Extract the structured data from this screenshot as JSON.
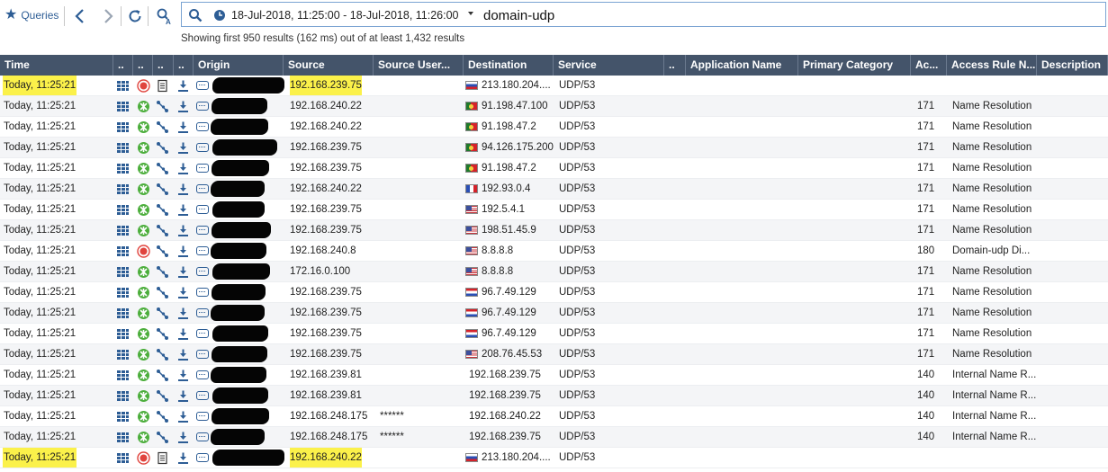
{
  "toolbar": {
    "queries_label": "Queries",
    "time_range": "18-Jul-2018, 11:25:00 - 18-Jul-2018, 11:26:00",
    "query": "domain-udp",
    "summary": "Showing first 950 results (162 ms) out of at least 1,432 results"
  },
  "colors": {
    "header_bg": "#44546a",
    "accent_blue": "#2d5d95",
    "highlight": "#fbf14a",
    "accept_green": "#4cae3c",
    "drop_red": "#e0443e"
  },
  "columns": [
    {
      "key": "time",
      "label": "Time"
    },
    {
      "key": "c1",
      "label": ".."
    },
    {
      "key": "c2",
      "label": ".."
    },
    {
      "key": "c3",
      "label": ".."
    },
    {
      "key": "c4",
      "label": ".."
    },
    {
      "key": "origin",
      "label": "Origin"
    },
    {
      "key": "source",
      "label": "Source"
    },
    {
      "key": "source_user",
      "label": "Source User..."
    },
    {
      "key": "destination",
      "label": "Destination"
    },
    {
      "key": "service",
      "label": "Service"
    },
    {
      "key": "c5",
      "label": ".."
    },
    {
      "key": "app",
      "label": "Application Name"
    },
    {
      "key": "category",
      "label": "Primary Category"
    },
    {
      "key": "ac",
      "label": "Ac..."
    },
    {
      "key": "rule_name",
      "label": "Access Rule N..."
    },
    {
      "key": "description",
      "label": "Description"
    }
  ],
  "icons": {
    "type": "grid-icon",
    "accept": "accept-icon",
    "drop": "drop-icon",
    "flow": "connection-icon",
    "doc": "log-document-icon",
    "download": "download-icon",
    "origin": "gateway-icon"
  },
  "rows": [
    {
      "time": "Today, 11:25:21",
      "action": "drop",
      "detail": "doc",
      "source": "192.168.239.75",
      "source_user": "",
      "flag": "ru",
      "destination": "213.180.204....",
      "service": "UDP/53",
      "ac": "",
      "rule_name": "",
      "time_hl": true,
      "src_hl": true,
      "redact_w": 80
    },
    {
      "time": "Today, 11:25:21",
      "action": "accept",
      "detail": "flow",
      "source": "192.168.240.22",
      "source_user": "",
      "flag": "pt",
      "destination": "91.198.47.100",
      "service": "UDP/53",
      "ac": "171",
      "rule_name": "Name Resolution",
      "redact_w": 62
    },
    {
      "time": "Today, 11:25:21",
      "action": "accept",
      "detail": "flow",
      "source": "192.168.240.22",
      "source_user": "",
      "flag": "pt",
      "destination": "91.198.47.2",
      "service": "UDP/53",
      "ac": "171",
      "rule_name": "Name Resolution",
      "redact_w": 64
    },
    {
      "time": "Today, 11:25:21",
      "action": "accept",
      "detail": "flow",
      "source": "192.168.239.75",
      "source_user": "",
      "flag": "pt",
      "destination": "94.126.175.200",
      "service": "UDP/53",
      "ac": "171",
      "rule_name": "Name Resolution",
      "redact_w": 72
    },
    {
      "time": "Today, 11:25:21",
      "action": "accept",
      "detail": "flow",
      "source": "192.168.239.75",
      "source_user": "",
      "flag": "pt",
      "destination": "91.198.47.2",
      "service": "UDP/53",
      "ac": "171",
      "rule_name": "Name Resolution",
      "redact_w": 64
    },
    {
      "time": "Today, 11:25:21",
      "action": "accept",
      "detail": "flow",
      "source": "192.168.240.22",
      "source_user": "",
      "flag": "fr",
      "destination": "192.93.0.4",
      "service": "UDP/53",
      "ac": "171",
      "rule_name": "Name Resolution",
      "redact_w": 60
    },
    {
      "time": "Today, 11:25:21",
      "action": "accept",
      "detail": "flow",
      "source": "192.168.239.75",
      "source_user": "",
      "flag": "us",
      "destination": "192.5.4.1",
      "service": "UDP/53",
      "ac": "171",
      "rule_name": "Name Resolution",
      "redact_w": 58
    },
    {
      "time": "Today, 11:25:21",
      "action": "accept",
      "detail": "flow",
      "source": "192.168.239.75",
      "source_user": "",
      "flag": "us",
      "destination": "198.51.45.9",
      "service": "UDP/53",
      "ac": "171",
      "rule_name": "Name Resolution",
      "redact_w": 66
    },
    {
      "time": "Today, 11:25:21",
      "action": "drop",
      "detail": "flow",
      "source": "192.168.240.8",
      "source_user": "",
      "flag": "us",
      "destination": "8.8.8.8",
      "service": "UDP/53",
      "ac": "180",
      "rule_name": "Domain-udp Di...",
      "redact_w": 62
    },
    {
      "time": "Today, 11:25:21",
      "action": "accept",
      "detail": "flow",
      "source": "172.16.0.100",
      "source_user": "",
      "flag": "us",
      "destination": "8.8.8.8",
      "service": "UDP/53",
      "ac": "171",
      "rule_name": "Name Resolution",
      "redact_w": 64
    },
    {
      "time": "Today, 11:25:21",
      "action": "accept",
      "detail": "flow",
      "source": "192.168.239.75",
      "source_user": "",
      "flag": "nl",
      "destination": "96.7.49.129",
      "service": "UDP/53",
      "ac": "171",
      "rule_name": "Name Resolution",
      "redact_w": 60
    },
    {
      "time": "Today, 11:25:21",
      "action": "accept",
      "detail": "flow",
      "source": "192.168.239.75",
      "source_user": "",
      "flag": "nl",
      "destination": "96.7.49.129",
      "service": "UDP/53",
      "ac": "171",
      "rule_name": "Name Resolution",
      "redact_w": 60
    },
    {
      "time": "Today, 11:25:21",
      "action": "accept",
      "detail": "flow",
      "source": "192.168.239.75",
      "source_user": "",
      "flag": "nl",
      "destination": "96.7.49.129",
      "service": "UDP/53",
      "ac": "171",
      "rule_name": "Name Resolution",
      "redact_w": 62
    },
    {
      "time": "Today, 11:25:21",
      "action": "accept",
      "detail": "flow",
      "source": "192.168.239.75",
      "source_user": "",
      "flag": "us",
      "destination": "208.76.45.53",
      "service": "UDP/53",
      "ac": "171",
      "rule_name": "Name Resolution",
      "redact_w": 62
    },
    {
      "time": "Today, 11:25:21",
      "action": "accept",
      "detail": "flow",
      "source": "192.168.239.81",
      "source_user": "",
      "flag": "none",
      "destination": "192.168.239.75",
      "service": "UDP/53",
      "ac": "140",
      "rule_name": "Internal Name R...",
      "redact_w": 62
    },
    {
      "time": "Today, 11:25:21",
      "action": "accept",
      "detail": "flow",
      "source": "192.168.239.81",
      "source_user": "",
      "flag": "none",
      "destination": "192.168.239.75",
      "service": "UDP/53",
      "ac": "140",
      "rule_name": "Internal Name R...",
      "redact_w": 62
    },
    {
      "time": "Today, 11:25:21",
      "action": "accept",
      "detail": "flow",
      "source": "192.168.248.175",
      "source_user": "******",
      "flag": "none",
      "destination": "192.168.240.22",
      "service": "UDP/53",
      "ac": "140",
      "rule_name": "Internal Name R...",
      "redact_w": 64
    },
    {
      "time": "Today, 11:25:21",
      "action": "accept",
      "detail": "flow",
      "source": "192.168.248.175",
      "source_user": "******",
      "flag": "none",
      "destination": "192.168.239.75",
      "service": "UDP/53",
      "ac": "140",
      "rule_name": "Internal Name R...",
      "redact_w": 60
    },
    {
      "time": "Today, 11:25:21",
      "action": "drop",
      "detail": "doc",
      "source": "192.168.240.22",
      "source_user": "",
      "flag": "ru",
      "destination": "213.180.204....",
      "service": "UDP/53",
      "ac": "",
      "rule_name": "",
      "time_hl": true,
      "src_hl": true,
      "redact_w": 80
    }
  ]
}
